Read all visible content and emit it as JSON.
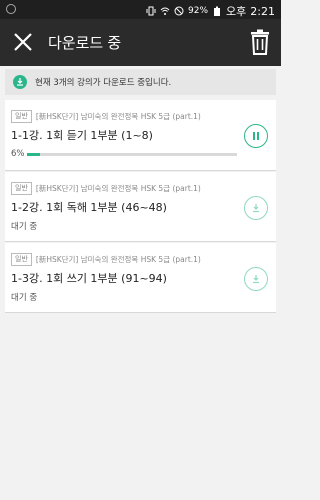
{
  "status_bar": {
    "battery": "92%",
    "ampm": "오후",
    "time": "2:21"
  },
  "header": {
    "title": "다운로드 중",
    "close_icon": "close-icon",
    "delete_icon": "trash-icon"
  },
  "notice": {
    "text": "현재 3개의 강의가 다운로드 중입니다."
  },
  "downloads": [
    {
      "badge": "일반",
      "course": "[新HSK단기] 남미숙의 완전정복 HSK 5급 (part.1)",
      "lesson": "1-1강. 1회 듣기 1부분 (1~8)",
      "status": "6%",
      "progress": 0.06,
      "action": "pause"
    },
    {
      "badge": "일반",
      "course": "[新HSK단기] 남미숙의 완전정복 HSK 5급 (part.1)",
      "lesson": "1-2강. 1회 독해 1부분 (46~48)",
      "status": "대기 중",
      "action": "download"
    },
    {
      "badge": "일반",
      "course": "[新HSK단기] 남미숙의 완전정복 HSK 5급 (part.1)",
      "lesson": "1-3강. 1회 쓰기 1부분 (91~94)",
      "status": "대기 중",
      "action": "download"
    }
  ],
  "colors": {
    "accent": "#2bb58b",
    "appbar": "#2b2b2b",
    "background": "#f2f2f2"
  }
}
